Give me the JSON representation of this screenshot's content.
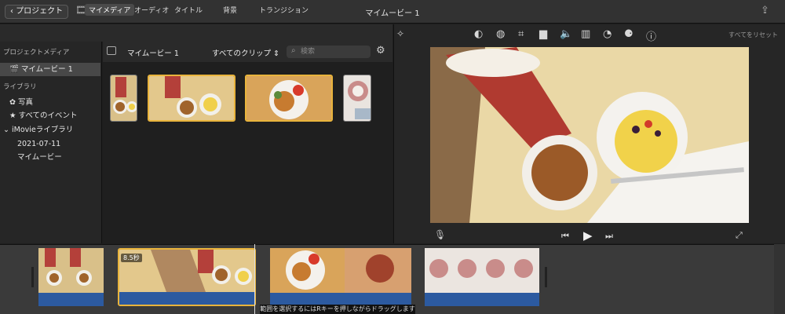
{
  "topbar": {
    "back_label": "プロジェクト",
    "title": "マイムービー 1"
  },
  "media_tabs": [
    {
      "label": "マイメディア",
      "active": true
    },
    {
      "label": "オーディオ",
      "active": false
    },
    {
      "label": "タイトル",
      "active": false
    },
    {
      "label": "背景",
      "active": false
    },
    {
      "label": "トランジション",
      "active": false
    }
  ],
  "sidebar": {
    "project_media_header": "プロジェクトメディア",
    "project_item": "マイムービー 1",
    "library_header": "ライブラリ",
    "items": [
      {
        "label": "写真",
        "icon": "photos-icon"
      },
      {
        "label": "すべてのイベント",
        "icon": "star-icon"
      },
      {
        "label": "iMovieライブラリ",
        "icon": "chevron-down-icon"
      },
      {
        "label": "2021-07-11",
        "icon": ""
      },
      {
        "label": "マイムービー",
        "icon": ""
      }
    ]
  },
  "browser": {
    "project_name": "マイムービー 1",
    "filter_label": "すべてのクリップ",
    "search_placeholder": "検索"
  },
  "viewer": {
    "reset_label": "すべてをリセット"
  },
  "timeline": {
    "clip_duration": "8.5秒",
    "hint": "範囲を選択するにはRキーを押しながらドラッグします"
  },
  "colors": {
    "selection": "#e9b43c",
    "audio": "#2c5aa0",
    "background": "#1e1e1e"
  }
}
